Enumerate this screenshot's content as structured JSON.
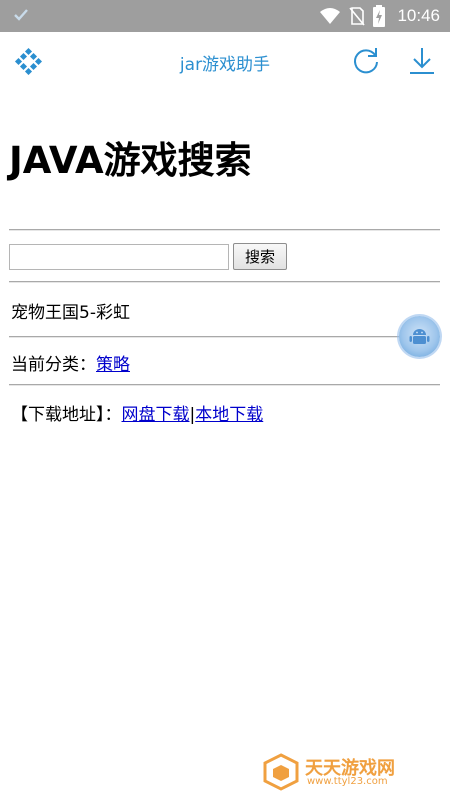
{
  "status_bar": {
    "time": "10:46",
    "icons": [
      "check-icon",
      "wifi-icon",
      "no-sim-icon",
      "battery-charging-icon"
    ],
    "background": "#9e9e9e"
  },
  "app_bar": {
    "title": "jar游戏助手",
    "accent": "#2b8fd0",
    "icons": [
      "menu-grid-icon",
      "refresh-icon",
      "download-icon"
    ]
  },
  "page": {
    "heading": "JAVA游戏搜索",
    "search": {
      "value": "",
      "placeholder": "",
      "button_label": "搜索"
    },
    "game_name": "宠物王国5-彩虹",
    "category_label": "当前分类：",
    "category_link": "策略",
    "download_label": "【下载地址】：",
    "download_links": [
      "网盘下载",
      "本地下载"
    ],
    "link_separator": "|",
    "link_color": "#0000cc"
  },
  "floating_button": {
    "icon": "android-icon"
  },
  "watermark": {
    "title": "天天游戏网",
    "url": "www.ttyl23.com",
    "color": "#f0a040"
  }
}
